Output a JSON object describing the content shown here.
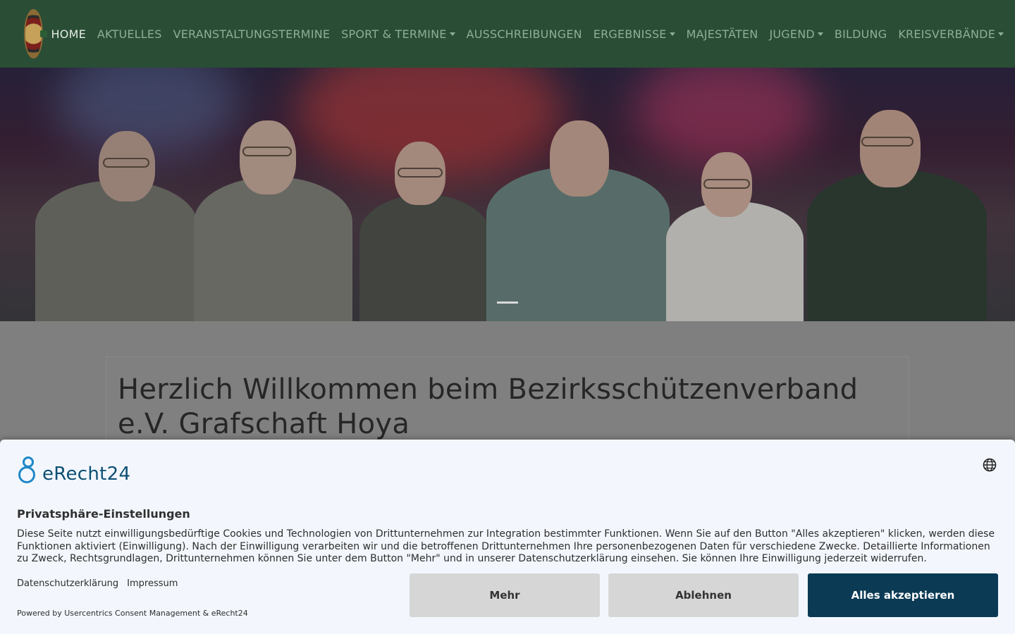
{
  "nav": {
    "items": [
      {
        "label": "HOME",
        "dropdown": false,
        "active": true
      },
      {
        "label": "AKTUELLES",
        "dropdown": false
      },
      {
        "label": "VERANSTALTUNGSTERMINE",
        "dropdown": false
      },
      {
        "label": "SPORT & TERMINE",
        "dropdown": true
      },
      {
        "label": "AUSSCHREIBUNGEN",
        "dropdown": false
      },
      {
        "label": "ERGEBNISSE",
        "dropdown": true
      },
      {
        "label": "MAJESTÄTEN",
        "dropdown": false
      },
      {
        "label": "JUGEND",
        "dropdown": true
      },
      {
        "label": "BILDUNG",
        "dropdown": false
      },
      {
        "label": "KREISVERBÄNDE",
        "dropdown": true
      }
    ]
  },
  "main": {
    "welcome_title": "Herzlich Willkommen beim Bezirksschützenverband e.V. Grafschaft Hoya"
  },
  "consent": {
    "brand": "eRecht24",
    "title": "Privatsphäre-Einstellungen",
    "text": "Diese Seite nutzt einwilligungsbedürftige Cookies und Technologien von Drittunternehmen zur Integration bestimmter Funktionen. Wenn Sie auf den Button \"Alles akzeptieren\" klicken, werden diese Funktionen aktiviert (Einwilligung). Nach der Einwilligung verarbeiten wir und die betroffenen Drittunternehmen Ihre personenbezogenen Daten für verschiedene Zwecke. Detaillierte Informationen zu Zweck, Rechtsgrundlagen, Drittunternehmen können Sie unter dem Button \"Mehr\" und in unserer Datenschutzerklärung einsehen. Sie können Ihre Einwilligung jederzeit widerrufen.",
    "link_privacy": "Datenschutzerklärung",
    "link_imprint": "Impressum",
    "powered": "Powered by Usercentrics Consent Management & eRecht24",
    "btn_more": "Mehr",
    "btn_reject": "Ablehnen",
    "btn_accept": "Alles akzeptieren"
  },
  "colors": {
    "navbar": "#2a4d35",
    "nav_text": "#8fae97",
    "accept_button": "#0b3a55",
    "brand_blue": "#1e88c8"
  },
  "icons": {
    "language": "globe-icon",
    "dropdown": "caret-down-icon"
  }
}
